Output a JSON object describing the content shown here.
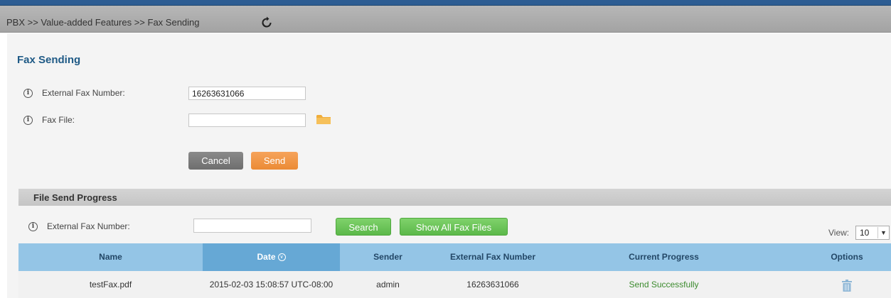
{
  "breadcrumb": "PBX >> Value-added Features >> Fax Sending",
  "page_title": "Fax Sending",
  "form": {
    "external_fax_label": "External Fax Number:",
    "external_fax_value": "16263631066",
    "fax_file_label": "Fax File:",
    "fax_file_value": "",
    "cancel_label": "Cancel",
    "send_label": "Send"
  },
  "progress_section": {
    "title": "File Send Progress",
    "filter_label": "External Fax Number:",
    "filter_value": "",
    "search_label": "Search",
    "show_all_label": "Show All Fax Files",
    "view_label": "View:",
    "view_value": "10"
  },
  "table": {
    "headers": {
      "name": "Name",
      "date": "Date",
      "sender": "Sender",
      "external_fax_number": "External Fax Number",
      "current_progress": "Current Progress",
      "options": "Options"
    },
    "rows": [
      {
        "name": "testFax.pdf",
        "date": "2015-02-03 15:08:57 UTC-08:00",
        "sender": "admin",
        "external_fax_number": "16263631066",
        "current_progress": "Send Successfully"
      }
    ]
  },
  "colors": {
    "accent": "#1f5a86",
    "send_button": "#eb8b35",
    "green_button": "#5cb84a",
    "table_header": "#94c5e6",
    "success_text": "#3c8b2e"
  },
  "icons": [
    "refresh-icon",
    "info-icon",
    "folder-icon",
    "sort-chevron-icon",
    "trash-icon"
  ]
}
